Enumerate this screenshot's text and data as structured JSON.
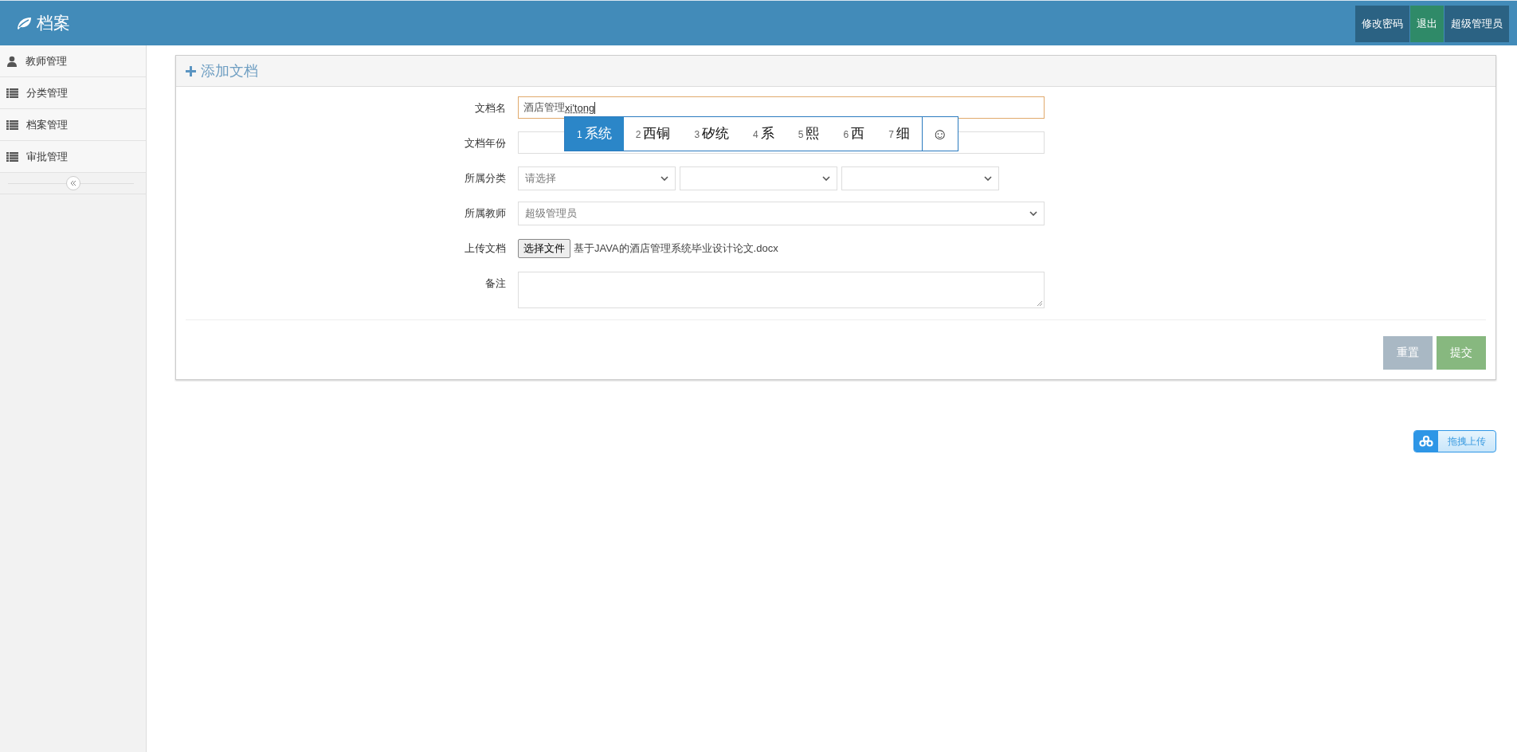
{
  "header": {
    "title": "档案",
    "buttons": [
      {
        "label": "修改密码",
        "kind": "dark"
      },
      {
        "label": "退出",
        "kind": "green"
      },
      {
        "label": "超级管理员",
        "kind": "dark"
      }
    ]
  },
  "sidebar": {
    "items": [
      {
        "label": "教师管理",
        "kind": "user"
      },
      {
        "label": "分类管理",
        "kind": "list"
      },
      {
        "label": "档案管理",
        "kind": "list"
      },
      {
        "label": "审批管理",
        "kind": "list"
      }
    ]
  },
  "panel": {
    "title": "添加文档",
    "fields": [
      {
        "label": "文档名",
        "kind": "text",
        "value": "酒店管理",
        "composition": "xi'tong",
        "focused": true
      },
      {
        "label": "文档年份",
        "kind": "text",
        "focused": false
      },
      {
        "label": "所属分类",
        "kind": "selects",
        "selects": [
          {
            "kind": "select",
            "value": "请选择"
          },
          {
            "kind": "select"
          },
          {
            "kind": "select"
          }
        ]
      },
      {
        "label": "所属教师",
        "kind": "select",
        "value": "超级管理员"
      },
      {
        "label": "上传文档",
        "kind": "file",
        "button": "选择文件",
        "filename": "基于JAVA的酒店管理系统毕业设计论文.docx"
      },
      {
        "label": "备注",
        "kind": "textarea"
      }
    ],
    "buttons": [
      {
        "label": "重置",
        "kind": "reset"
      },
      {
        "label": "提交",
        "kind": "submit"
      }
    ]
  },
  "ime": {
    "candidates": [
      {
        "number": "1",
        "text": "系统",
        "selected": true
      },
      {
        "number": "2",
        "text": "西铜",
        "selected": false
      },
      {
        "number": "3",
        "text": "矽统",
        "selected": false
      },
      {
        "number": "4",
        "text": "系",
        "selected": false
      },
      {
        "number": "5",
        "text": "熙",
        "selected": false
      },
      {
        "number": "6",
        "text": "西",
        "selected": false
      },
      {
        "number": "7",
        "text": "细",
        "selected": false
      }
    ],
    "emoji": "☺"
  },
  "upload_widget": {
    "label": "拖拽上传"
  }
}
